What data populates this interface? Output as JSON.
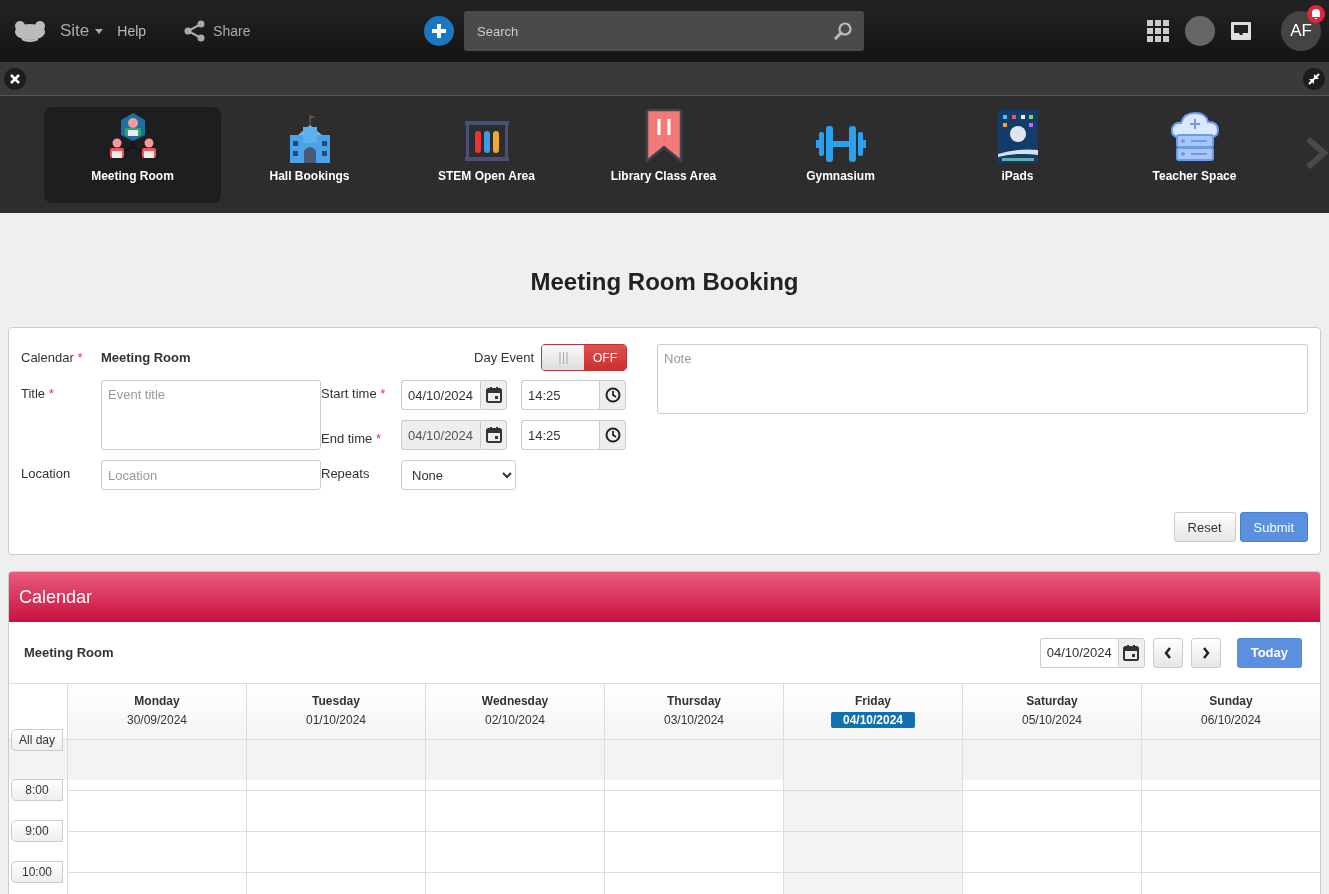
{
  "topbar": {
    "site": "Site",
    "help": "Help",
    "share": "Share",
    "search": {
      "placeholder": "Search"
    },
    "avatar": "AF",
    "notification": true
  },
  "tiles": [
    {
      "label": "Meeting Room",
      "selected": true,
      "kind": "meeting"
    },
    {
      "label": "Hall Bookings",
      "selected": false,
      "kind": "hall"
    },
    {
      "label": "STEM Open Area",
      "selected": false,
      "kind": "stem"
    },
    {
      "label": "Library Class Area",
      "selected": false,
      "kind": "library"
    },
    {
      "label": "Gymnasium",
      "selected": false,
      "kind": "gym"
    },
    {
      "label": "iPads",
      "selected": false,
      "kind": "ipad"
    },
    {
      "label": "Teacher Space",
      "selected": false,
      "kind": "cloud"
    }
  ],
  "page_title": "Meeting Room Booking",
  "form": {
    "calendar": {
      "label": "Calendar",
      "required_mark": "*",
      "value": "Meeting Room"
    },
    "title": {
      "label": "Title",
      "required_mark": "*",
      "placeholder": "Event title"
    },
    "location": {
      "label": "Location",
      "placeholder": "Location"
    },
    "start": {
      "label": "Start time",
      "required_mark": "*",
      "date": "04/10/2024",
      "date_disabled": false,
      "time": "14:25"
    },
    "end": {
      "label": "End time",
      "required_mark": "*",
      "date": "04/10/2024",
      "date_disabled": true,
      "time": "14:25"
    },
    "repeats": {
      "label": "Repeats",
      "value": "None"
    },
    "day_event": {
      "label": "Day Event",
      "on": false,
      "text": "OFF"
    },
    "note": {
      "placeholder": "Note"
    },
    "buttons": [
      {
        "label": "Reset",
        "kind": "default"
      },
      {
        "label": "Submit",
        "kind": "primary"
      }
    ]
  },
  "calendar": {
    "title": "Calendar",
    "name": "Meeting Room",
    "date": "04/10/2024",
    "today": "Today",
    "days": [
      {
        "name": "Monday",
        "date": "30/09/2024",
        "selected": false
      },
      {
        "name": "Tuesday",
        "date": "01/10/2024",
        "selected": false
      },
      {
        "name": "Wednesday",
        "date": "02/10/2024",
        "selected": false
      },
      {
        "name": "Thursday",
        "date": "03/10/2024",
        "selected": false
      },
      {
        "name": "Friday",
        "date": "04/10/2024",
        "selected": true
      },
      {
        "name": "Saturday",
        "date": "05/10/2024",
        "selected": false
      },
      {
        "name": "Sunday",
        "date": "06/10/2024",
        "selected": false
      }
    ],
    "all_day": "All day",
    "hours": [
      "8:00",
      "9:00",
      "10:00"
    ]
  }
}
